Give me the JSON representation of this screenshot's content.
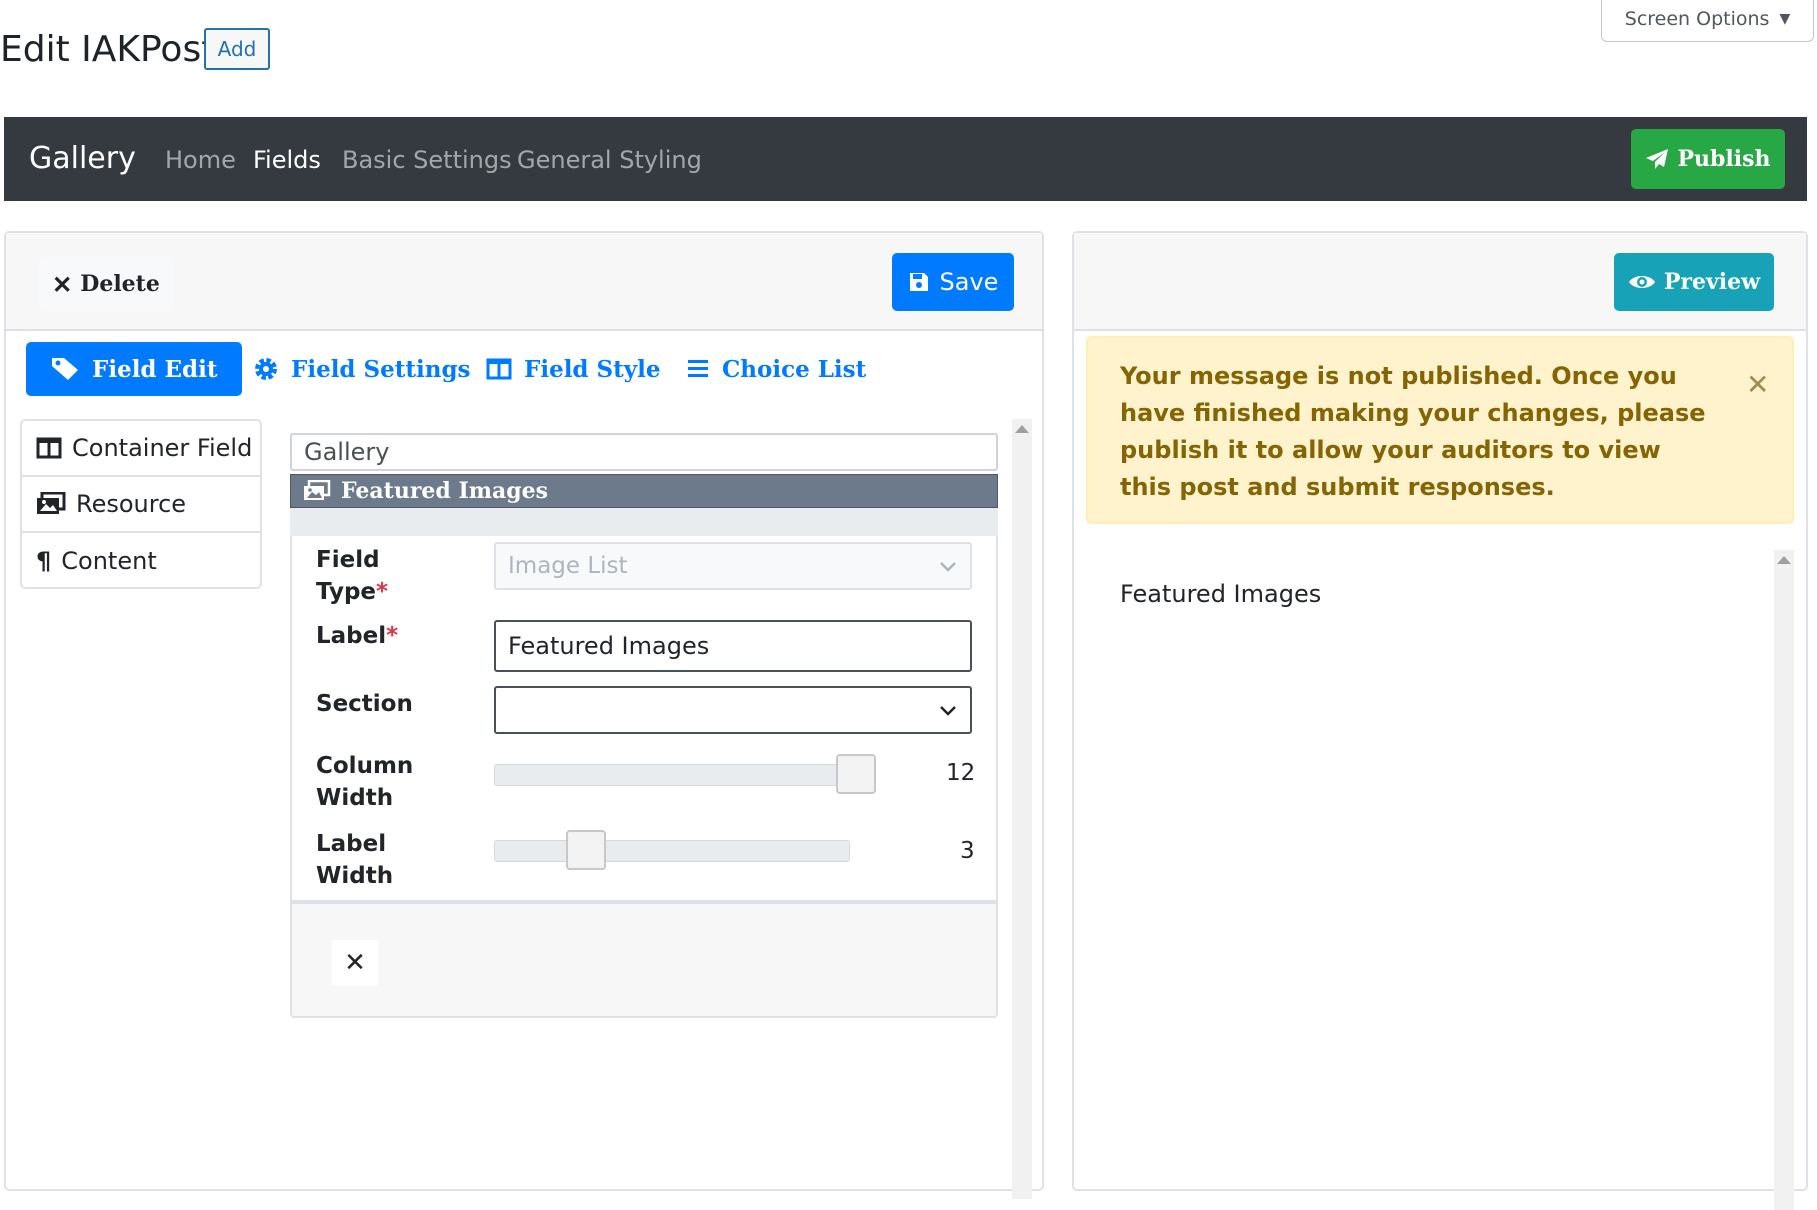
{
  "header": {
    "page_title": "Edit IAKPost",
    "add_label": "Add",
    "screen_options_label": "Screen Options"
  },
  "navbar": {
    "brand": "Gallery",
    "links": [
      "Home",
      "Fields",
      "Basic Settings",
      "General Styling"
    ],
    "active_link": "Fields",
    "publish_label": "Publish"
  },
  "editor": {
    "delete_label": "Delete",
    "save_label": "Save",
    "tabs": [
      "Field Edit",
      "Field Settings",
      "Field Style",
      "Choice List"
    ],
    "active_tab": "Field Edit",
    "side_items": [
      "Container Field",
      "Resource",
      "Content"
    ],
    "container_title": "Gallery",
    "section_title": "Featured Images",
    "form": {
      "field_type_label_1": "Field",
      "field_type_label_2": "Type",
      "field_type_value": "Image List",
      "label_label": "Label",
      "label_value": "Featured Images",
      "section_label": "Section",
      "section_value": "",
      "column_width_label_1": "Column",
      "column_width_label_2": "Width",
      "column_width_value": "12",
      "column_width_max": 12,
      "label_width_label_1": "Label",
      "label_width_label_2": "Width",
      "label_width_value": "3",
      "label_width_max": 12,
      "required_mark": "*"
    }
  },
  "preview": {
    "preview_label": "Preview",
    "alert_text": "Your message is not published. Once you have finished making your changes, please publish it to allow your auditors to view this post and submit responses.",
    "field_label": "Featured Images"
  },
  "colors": {
    "navbar_bg": "#343a40",
    "primary": "#007bff",
    "success": "#28a745",
    "info": "#17a2b8",
    "warning_bg": "#fff3cd",
    "warning_text": "#856404",
    "section_bar": "#6c7a8c"
  }
}
